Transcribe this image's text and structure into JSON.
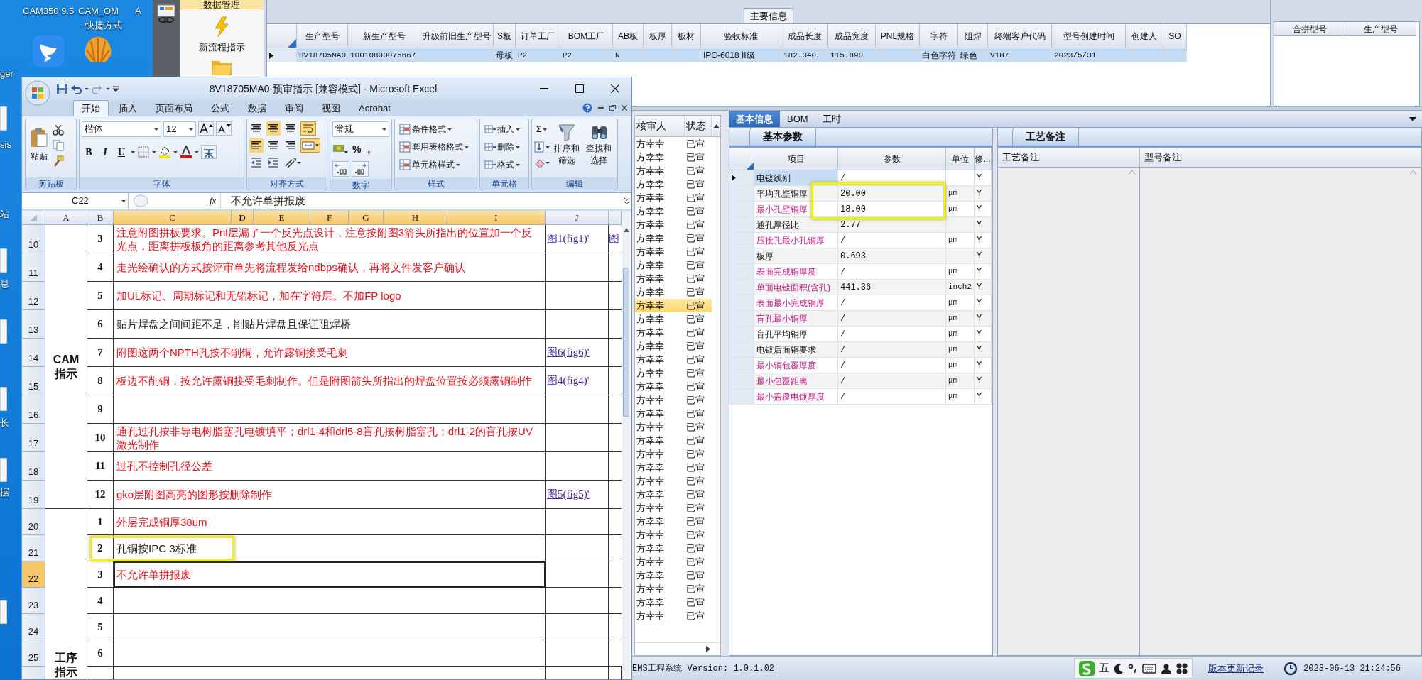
{
  "desktop": {
    "labels": [
      "CAM350 9.5",
      "CAM_OM",
      "- 快捷方式",
      "A",
      "ger",
      "sis",
      "站",
      "息",
      "长",
      "据"
    ]
  },
  "app": {
    "nav": {
      "tab": "数据管理",
      "items": [
        {
          "label": "新流程指示"
        }
      ]
    },
    "main_info": {
      "title": "主要信息",
      "columns": [
        "生产型号",
        "新生产型号",
        "升级前旧生产型号",
        "S板",
        "订单工厂",
        "BOM工厂",
        "AB板",
        "板厚",
        "板材",
        "验收标准",
        "成品长度",
        "成品宽度",
        "PNL规格",
        "字符",
        "阻焊",
        "终端客户代码",
        "型号创建时间",
        "创建人",
        "SO"
      ],
      "rows": [
        {
          "selected": true,
          "cells": [
            "8V18705MA0",
            "10010800075667",
            null,
            "母板",
            "P2",
            "P2",
            "N",
            null,
            null,
            "IPC-6018 II级",
            "182.340",
            "115.890",
            null,
            "白色字符",
            "绿色",
            "V187",
            "2023/5/31",
            null,
            null
          ]
        }
      ],
      "side_columns": [
        "合拼型号",
        "生产型号"
      ]
    },
    "review_list": {
      "columns": [
        "核审人",
        "状态"
      ],
      "rows": [
        {
          "reviewer": "方幸幸",
          "status": "已审",
          "selected": false
        },
        {
          "reviewer": "方幸幸",
          "status": "已审",
          "selected": false
        },
        {
          "reviewer": "方幸幸",
          "status": "已审",
          "selected": false
        },
        {
          "reviewer": "方幸幸",
          "status": "已审",
          "selected": false
        },
        {
          "reviewer": "方幸幸",
          "status": "已审",
          "selected": false
        },
        {
          "reviewer": "方幸幸",
          "status": "已审",
          "selected": false
        },
        {
          "reviewer": "方幸幸",
          "status": "已审",
          "selected": false
        },
        {
          "reviewer": "方幸幸",
          "status": "已审",
          "selected": false
        },
        {
          "reviewer": "方幸幸",
          "status": "已审",
          "selected": false
        },
        {
          "reviewer": "方幸幸",
          "status": "已审",
          "selected": false
        },
        {
          "reviewer": "方幸幸",
          "status": "已审",
          "selected": false
        },
        {
          "reviewer": "方幸幸",
          "status": "已审",
          "selected": false
        },
        {
          "reviewer": "方幸幸",
          "status": "已审",
          "selected": true
        },
        {
          "reviewer": "方幸幸",
          "status": "已审",
          "selected": false
        },
        {
          "reviewer": "方幸幸",
          "status": "已审",
          "selected": false
        },
        {
          "reviewer": "方幸幸",
          "status": "已审",
          "selected": false
        },
        {
          "reviewer": "方幸幸",
          "status": "已审",
          "selected": false
        },
        {
          "reviewer": "方幸幸",
          "status": "已审",
          "selected": false
        },
        {
          "reviewer": "方幸幸",
          "status": "已审",
          "selected": false
        },
        {
          "reviewer": "方幸幸",
          "status": "已审",
          "selected": false
        },
        {
          "reviewer": "方幸幸",
          "status": "已审",
          "selected": false
        },
        {
          "reviewer": "方幸幸",
          "status": "已审",
          "selected": false
        },
        {
          "reviewer": "方幸幸",
          "status": "已审",
          "selected": false
        },
        {
          "reviewer": "方幸幸",
          "status": "已审",
          "selected": false
        },
        {
          "reviewer": "方幸幸",
          "status": "已审",
          "selected": false
        },
        {
          "reviewer": "方幸幸",
          "status": "已审",
          "selected": false
        },
        {
          "reviewer": "方幸幸",
          "status": "已审",
          "selected": false
        },
        {
          "reviewer": "方幸幸",
          "status": "已审",
          "selected": false
        },
        {
          "reviewer": "方幸幸",
          "status": "已审",
          "selected": false
        },
        {
          "reviewer": "方幸幸",
          "status": "已审",
          "selected": false
        },
        {
          "reviewer": "方幸幸",
          "status": "已审",
          "selected": false
        },
        {
          "reviewer": "方幸幸",
          "status": "已审",
          "selected": false
        },
        {
          "reviewer": "方幸幸",
          "status": "已审",
          "selected": false
        },
        {
          "reviewer": "方幸幸",
          "status": "已审",
          "selected": false
        },
        {
          "reviewer": "方幸幸",
          "status": "已审",
          "selected": false
        },
        {
          "reviewer": "方幸幸",
          "status": "已审",
          "selected": false
        }
      ]
    },
    "detail_tabs": [
      {
        "label": "基本信息",
        "selected": true
      },
      {
        "label": "BOM",
        "selected": false
      },
      {
        "label": "工时",
        "selected": false
      }
    ],
    "params": {
      "tab": "基本参数",
      "columns": [
        "项目",
        "参数",
        "单位",
        "修..."
      ],
      "rows": [
        {
          "item": "电镀线别",
          "value": "/",
          "flag": "Y",
          "flagged": false,
          "selected": true
        },
        {
          "item": "平均孔壁铜厚",
          "value": "20.00",
          "unit": "μm",
          "flag": "Y",
          "flagged": false,
          "selected": false
        },
        {
          "item": "最小孔壁铜厚",
          "value": "18.00",
          "unit": "μm",
          "flag": "Y",
          "flagged": true,
          "selected": false
        },
        {
          "item": "通孔厚径比",
          "value": "2.77",
          "flag": "Y",
          "flagged": false,
          "selected": false
        },
        {
          "item": "压接孔最小孔铜厚",
          "value": "/",
          "unit": "μm",
          "flag": "Y",
          "flagged": true,
          "selected": false
        },
        {
          "item": "板厚",
          "value": "0.693",
          "flag": "Y",
          "flagged": false,
          "selected": false
        },
        {
          "item": "表面完成铜厚度",
          "value": "/",
          "unit": "μm",
          "flag": "Y",
          "flagged": true,
          "selected": false
        },
        {
          "item": "单面电镀面积(含孔)",
          "value": "441.36",
          "unit": "inch2",
          "flag": "Y",
          "flagged": true,
          "selected": false
        },
        {
          "item": "表面最小完成铜厚",
          "value": "/",
          "unit": "μm",
          "flag": "Y",
          "flagged": true,
          "selected": false
        },
        {
          "item": "盲孔最小铜厚",
          "value": "/",
          "unit": "μm",
          "flag": "Y",
          "flagged": true,
          "selected": false
        },
        {
          "item": "盲孔平均铜厚",
          "value": "/",
          "unit": "μm",
          "flag": "Y",
          "flagged": false,
          "selected": false
        },
        {
          "item": "电镀后面铜要求",
          "value": "/",
          "unit": "μm",
          "flag": "Y",
          "flagged": false,
          "selected": false
        },
        {
          "item": "最小铜包覆厚度",
          "value": "/",
          "unit": "μm",
          "flag": "Y",
          "flagged": true,
          "selected": false
        },
        {
          "item": "最小包覆距离",
          "value": "/",
          "unit": "μm",
          "flag": "Y",
          "flagged": true,
          "selected": false
        },
        {
          "item": "最小盖覆电镀厚度",
          "value": "/",
          "unit": "μm",
          "flag": "Y",
          "flagged": true,
          "selected": false
        }
      ]
    },
    "notes": {
      "tab": "工艺备注",
      "columns": [
        "工艺备注",
        "型号备注"
      ]
    },
    "status_bar": {
      "product": "EMS工程系统",
      "version": "Version: 1.0.1.02",
      "ime_mode": "五",
      "link": "版本更新记录",
      "clock": "2023-06-13 21:24:56"
    }
  },
  "excel": {
    "title": "8V18705MA0-预审指示  [兼容模式] - Microsoft Excel",
    "tabs": [
      {
        "label": "开始",
        "selected": true
      },
      {
        "label": "插入",
        "selected": false
      },
      {
        "label": "页面布局",
        "selected": false
      },
      {
        "label": "公式",
        "selected": false
      },
      {
        "label": "数据",
        "selected": false
      },
      {
        "label": "审阅",
        "selected": false
      },
      {
        "label": "视图",
        "selected": false
      },
      {
        "label": "Acrobat",
        "selected": false
      }
    ],
    "ribbon": {
      "paste": "粘贴",
      "font_name": "楷体",
      "font_size": "12",
      "font_buttons": [
        "B",
        "I",
        "U"
      ],
      "number_format": "常规",
      "number_buttons": [
        "%",
        ","
      ],
      "styles": [
        "条件格式",
        "套用表格格式",
        "单元格样式"
      ],
      "cells": [
        "插入",
        "删除",
        "格式"
      ],
      "sum": "Σ",
      "sort": [
        "排序和",
        "筛选"
      ],
      "find": [
        "查找和",
        "选择"
      ],
      "groups": [
        "剪贴板",
        "字体",
        "对齐方式",
        "数字",
        "样式",
        "单元格",
        "编辑"
      ]
    },
    "name_box": "C22",
    "fx": "fx",
    "formula": "不允许单拼报废",
    "columns": [
      {
        "label": "A",
        "selected": false
      },
      {
        "label": "B",
        "selected": false
      },
      {
        "label": "C",
        "selected": true
      },
      {
        "label": "D",
        "selected": true
      },
      {
        "label": "E",
        "selected": true
      },
      {
        "label": "F",
        "selected": true
      },
      {
        "label": "G",
        "selected": true
      },
      {
        "label": "H",
        "selected": true
      },
      {
        "label": "I",
        "selected": true
      },
      {
        "label": "J",
        "selected": false
      }
    ],
    "sections": [
      {
        "label": "CAM 指示",
        "rows": [
          {
            "num": "10",
            "step": "3",
            "text": "注意附图拼板要求。Pnl层漏了一个反光点设计，注意按附图3箭头所指出的位置加一个反光点，距离拼板板角的距离参考其他反光点",
            "color": "#e3101c",
            "link": "图1(fig1)'",
            "extra": "图",
            "selected": false
          },
          {
            "num": "11",
            "step": "4",
            "text": "走光绘确认的方式按评审单先将流程发给ndbps确认，再将文件发客户确认",
            "color": "#e3101c",
            "selected": false
          },
          {
            "num": "12",
            "step": "5",
            "text": "加UL标记、周期标记和无铅标记，加在字符层。不加FP logo",
            "color": "#e3101c",
            "selected": false
          },
          {
            "num": "13",
            "step": "6",
            "text": "贴片焊盘之间间距不足，削贴片焊盘且保证阻焊桥",
            "color": "#222222",
            "selected": false
          },
          {
            "num": "14",
            "step": "7",
            "text": "附图这两个NPTH孔按不削铜，允许露铜接受毛刺",
            "color": "#e3101c",
            "link": "图6(fig6)'",
            "selected": false
          },
          {
            "num": "15",
            "step": "8",
            "text": "板边不削铜，按允许露铜接受毛刺制作。但是附图箭头所指出的焊盘位置按必须露铜制作",
            "color": "#e3101c",
            "link": "图4(fig4)'",
            "selected": false
          },
          {
            "num": "16",
            "step": "9",
            "selected": false
          },
          {
            "num": "17",
            "step": "10",
            "text": "通孔过孔按非导电树脂塞孔电镀填平；drl1-4和drl5-8盲孔按树脂塞孔；drl1-2的盲孔按UV激光制作",
            "color": "#e3101c",
            "selected": false
          },
          {
            "num": "18",
            "step": "11",
            "text": "过孔不控制孔径公差",
            "color": "#e3101c",
            "selected": false
          },
          {
            "num": "19",
            "step": "12",
            "text": "gko层附图高亮的图形按删除制作",
            "color": "#e3101c",
            "link": "图5(fig5)'",
            "selected": false
          }
        ]
      },
      {
        "label": "工序指示",
        "rows": [
          {
            "num": "20",
            "step": "1",
            "text": "外层完成铜厚38um",
            "color": "#e3101c",
            "selected": false
          },
          {
            "num": "21",
            "step": "2",
            "text": "孔铜按IPC 3标准",
            "color": "#222222",
            "selected": false
          },
          {
            "num": "22",
            "step": "3",
            "text": "不允许单拼报废",
            "color": "#e3101c",
            "selected": true
          },
          {
            "num": "23",
            "step": "4",
            "selected": false
          },
          {
            "num": "24",
            "step": "5",
            "selected": false
          },
          {
            "num": "25",
            "step": "6",
            "selected": false
          }
        ]
      }
    ]
  }
}
